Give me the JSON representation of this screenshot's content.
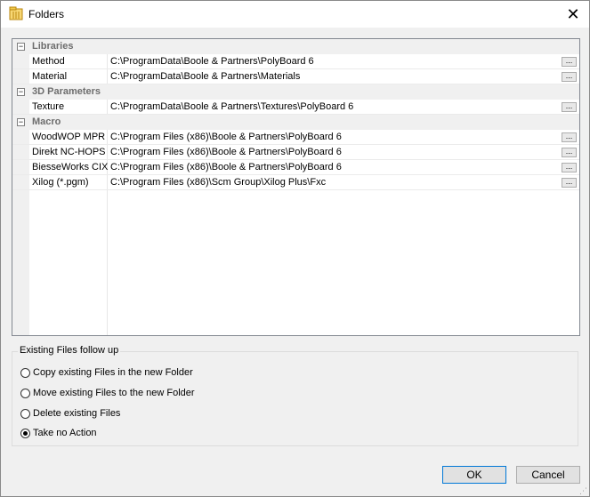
{
  "window": {
    "title": "Folders",
    "close_glyph": "✕"
  },
  "property_grid": {
    "categories": [
      {
        "label": "Libraries",
        "expander": "−",
        "items": [
          {
            "name": "Method",
            "value": "C:\\ProgramData\\Boole & Partners\\PolyBoard 6",
            "button": "..."
          },
          {
            "name": "Material",
            "value": "C:\\ProgramData\\Boole & Partners\\Materials",
            "button": "..."
          }
        ]
      },
      {
        "label": "3D Parameters",
        "expander": "−",
        "items": [
          {
            "name": "Texture",
            "value": "C:\\ProgramData\\Boole & Partners\\Textures\\PolyBoard 6",
            "button": "..."
          }
        ]
      },
      {
        "label": "Macro",
        "expander": "−",
        "items": [
          {
            "name": "WoodWOP MPR",
            "value": "C:\\Program Files (x86)\\Boole & Partners\\PolyBoard 6",
            "button": "..."
          },
          {
            "name": "Direkt NC-HOPS",
            "value": "C:\\Program Files (x86)\\Boole & Partners\\PolyBoard 6",
            "button": "..."
          },
          {
            "name": "BiesseWorks CIX",
            "value": "C:\\Program Files (x86)\\Boole & Partners\\PolyBoard 6",
            "button": "..."
          },
          {
            "name": "Xilog (*.pgm)",
            "value": "C:\\Program Files (x86)\\Scm Group\\Xilog Plus\\Fxc",
            "button": "..."
          }
        ]
      }
    ]
  },
  "existing_files": {
    "title": "Existing Files follow up",
    "options": [
      {
        "label": "Copy existing Files in the new Folder",
        "checked": false
      },
      {
        "label": "Move existing Files to the new Folder",
        "checked": false
      },
      {
        "label": "Delete existing Files",
        "checked": false
      },
      {
        "label": "Take no Action",
        "checked": true
      }
    ]
  },
  "buttons": {
    "ok": "OK",
    "cancel": "Cancel"
  },
  "colors": {
    "default_button_border": "#0078d7",
    "category_text": "#6d6d6d"
  },
  "icons": {
    "app": "folders-app-icon",
    "close": "close-icon",
    "expander": "collapse-icon",
    "grip": "resize-grip-icon"
  }
}
